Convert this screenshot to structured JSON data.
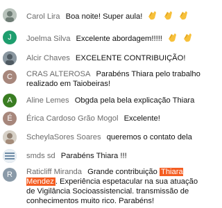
{
  "chat": {
    "messages": [
      {
        "author": "Carol Lira",
        "text": "Boa noite! Super aula!",
        "claps": 3,
        "avatar_letter": "",
        "avatar_color": "#9aa7a0"
      },
      {
        "author": "Joelma Silva",
        "text": "Excelente abordagem!!!!!",
        "claps": 2,
        "avatar_letter": "J",
        "avatar_color": "#1e9e6e"
      },
      {
        "author": "Alcir Chaves",
        "text": "EXCELENTE CONTRIBUIÇÃO!",
        "claps": 0,
        "avatar_letter": "",
        "avatar_color": "#7d8a94"
      },
      {
        "author": "CRAS ALTEROSA",
        "text": "Parabéns Thiara pelo trabalho realizado em Taiobeiras!",
        "claps": 0,
        "avatar_letter": "C",
        "avatar_color": "#a7877c"
      },
      {
        "author": "Aline Lemes",
        "text": "Obgda pela bela explicação Thiara",
        "claps": 0,
        "avatar_letter": "A",
        "avatar_color": "#3a7d22"
      },
      {
        "author": "Érica Cardoso Grão Mogol",
        "text": "Excelente!",
        "claps": 0,
        "avatar_letter": "É",
        "avatar_color": "#a7877c"
      },
      {
        "author": "ScheylaSores Soares",
        "text": "queremos o contato dela",
        "claps": 0,
        "avatar_letter": "",
        "avatar_color": "#c7c2b8"
      },
      {
        "author": "smds sd",
        "text": "Parabéns Thiara !!!",
        "claps": 0,
        "avatar_letter": "",
        "avatar_color": "#8aa6bf"
      },
      {
        "author": "Raticliff Miranda",
        "text_before": "Grande contribuição",
        "highlight": "Thiara Mendez",
        "text_after": ". Experiência espetacular na sua atuação de Vigilância Socioassistencial. transmissão de conhecimentos muito rico. Parabéns!",
        "avatar_letter": "R",
        "avatar_color": "#8a9aa8"
      }
    ]
  }
}
